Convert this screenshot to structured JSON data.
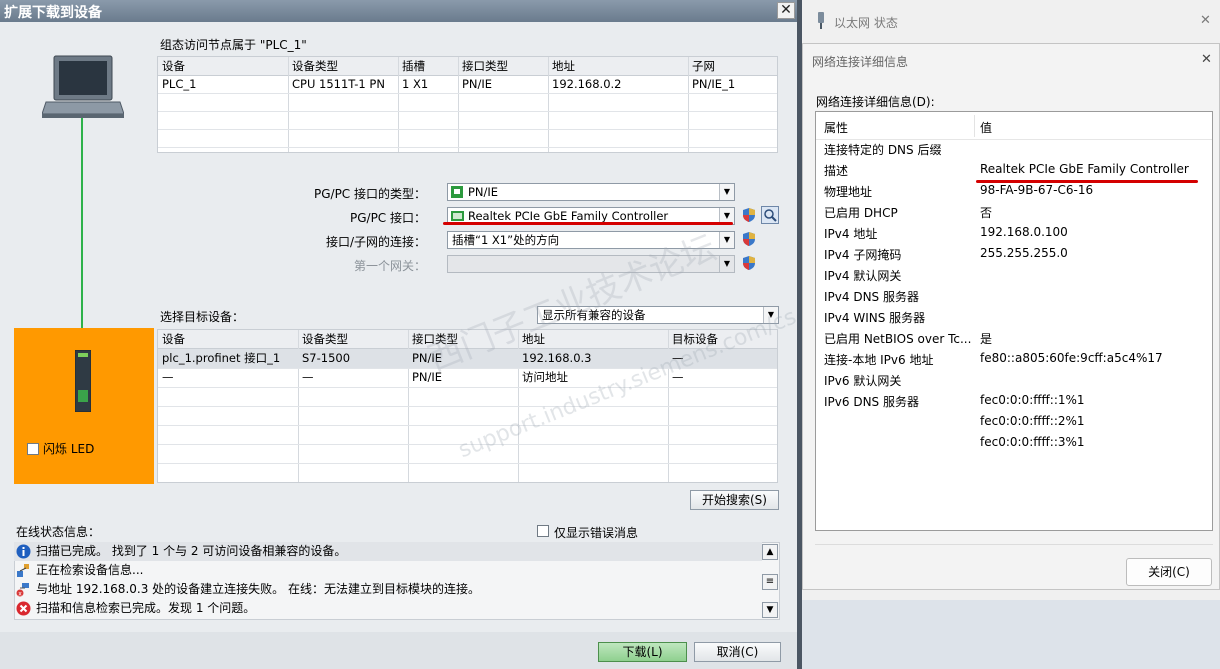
{
  "left_dialog": {
    "title": "扩展下载到设备",
    "close_glyph": "✕",
    "access_node_label": "组态访问节点属于 \"PLC_1\"",
    "config_table": {
      "headers": [
        "设备",
        "设备类型",
        "插槽",
        "接口类型",
        "地址",
        "子网"
      ],
      "rows": [
        [
          "PLC_1",
          "CPU 1511T-1 PN",
          "1 X1",
          "PN/IE",
          "192.168.0.2",
          "PN/IE_1"
        ]
      ]
    },
    "pgpc_type_label": "PG/PC 接口的类型：",
    "pgpc_type_value": "PN/IE",
    "pgpc_if_label": "PG/PC 接口：",
    "pgpc_if_value": "Realtek PCIe GbE Family Controller",
    "subnet_conn_label": "接口/子网的连接：",
    "subnet_conn_value": "插槽“1 X1”处的方向",
    "gateway_label": "第一个网关：",
    "gateway_value": "",
    "select_target_label": "选择目标设备：",
    "display_filter_value": "显示所有兼容的设备",
    "target_table": {
      "headers": [
        "设备",
        "设备类型",
        "接口类型",
        "地址",
        "目标设备"
      ],
      "rows": [
        [
          "plc_1.profinet 接口_1",
          "S7-1500",
          "PN/IE",
          "192.168.0.3",
          "—"
        ],
        [
          "—",
          "—",
          "PN/IE",
          "访问地址",
          "—"
        ]
      ]
    },
    "flash_led_label": "闪烁 LED",
    "start_search_label": "开始搜索(S)",
    "online_status_label": "在线状态信息：",
    "only_errors_label": "仅显示错误消息",
    "messages": [
      {
        "icon": "info-icon",
        "text": "扫描已完成。 找到了 1 个与 2 可访问设备相兼容的设备。"
      },
      {
        "icon": "search-devices-icon",
        "text": "正在检索设备信息..."
      },
      {
        "icon": "connection-failed-icon",
        "text": "与地址 192.168.0.3 处的设备建立连接失败。 在线：无法建立到目标模块的连接。"
      },
      {
        "icon": "error-icon",
        "text": "扫描和信息检索已完成。发现 1 个问题。"
      }
    ],
    "download_label": "下载(L)",
    "cancel_label": "取消(C)",
    "watermark_cn": "西门子工业技术论坛",
    "watermark_url": "support.industry.siemens.com/cs"
  },
  "status_window": {
    "title": "以太网 状态",
    "close_glyph": "✕"
  },
  "details_dialog": {
    "title": "网络连接详细信息",
    "close_glyph": "✕",
    "section_label": "网络连接详细信息(D):",
    "col_property": "属性",
    "col_value": "值",
    "rows": [
      {
        "property": "连接特定的 DNS 后缀",
        "value": ""
      },
      {
        "property": "描述",
        "value": "Realtek PCIe GbE Family Controller"
      },
      {
        "property": "物理地址",
        "value": "98-FA-9B-67-C6-16"
      },
      {
        "property": "已启用 DHCP",
        "value": "否"
      },
      {
        "property": "IPv4 地址",
        "value": "192.168.0.100"
      },
      {
        "property": "IPv4 子网掩码",
        "value": "255.255.255.0"
      },
      {
        "property": "IPv4 默认网关",
        "value": ""
      },
      {
        "property": "IPv4 DNS 服务器",
        "value": ""
      },
      {
        "property": "IPv4 WINS 服务器",
        "value": ""
      },
      {
        "property": "已启用 NetBIOS over Tc...",
        "value": "是"
      },
      {
        "property": "连接-本地 IPv6 地址",
        "value": "fe80::a805:60fe:9cff:a5c4%17"
      },
      {
        "property": "IPv6 默认网关",
        "value": ""
      },
      {
        "property": "IPv6 DNS 服务器",
        "value": "fec0:0:0:ffff::1%1"
      },
      {
        "property": "",
        "value": "fec0:0:0:ffff::2%1"
      },
      {
        "property": "",
        "value": "fec0:0:0:ffff::3%1"
      }
    ],
    "close_button_label": "关闭(C)"
  },
  "colors": {
    "accent_orange": "#ff9900",
    "highlight_red": "#d40000",
    "link_green": "#2db24a"
  }
}
